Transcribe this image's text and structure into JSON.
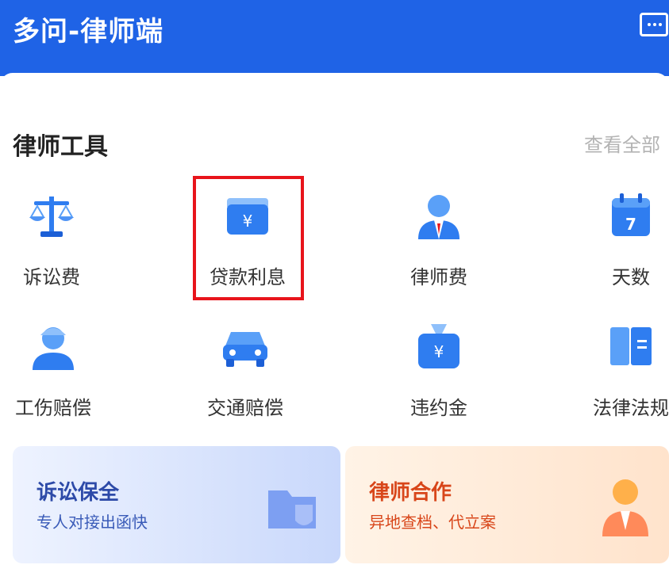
{
  "header": {
    "title": "多问-律师端",
    "message_icon": "chat-bubble-icon",
    "bg_color": "#1f63e6"
  },
  "tools_section": {
    "title": "律师工具",
    "view_all": "查看全部",
    "items": [
      {
        "label": "诉讼费",
        "icon": "scale-icon"
      },
      {
        "label": "贷款利息",
        "icon": "wallet-yen-icon",
        "highlighted": true
      },
      {
        "label": "律师费",
        "icon": "lawyer-icon"
      },
      {
        "label": "天数",
        "icon": "calendar-icon"
      },
      {
        "label": "工伤赔偿",
        "icon": "worker-icon"
      },
      {
        "label": "交通赔偿",
        "icon": "car-icon"
      },
      {
        "label": "违约金",
        "icon": "money-bag-icon"
      },
      {
        "label": "法律法规",
        "icon": "law-book-icon"
      }
    ]
  },
  "promos": [
    {
      "title": "诉讼保全",
      "subtitle": "专人对接出函快",
      "icon": "folder-shield-icon",
      "title_color": "#2d4aa8"
    },
    {
      "title": "律师合作",
      "subtitle": "异地查档、代立案",
      "icon": "lawyer-avatar-icon",
      "title_color": "#d8461a"
    }
  ],
  "accent_color": "#2f7df0",
  "highlight_color": "#e8141b"
}
